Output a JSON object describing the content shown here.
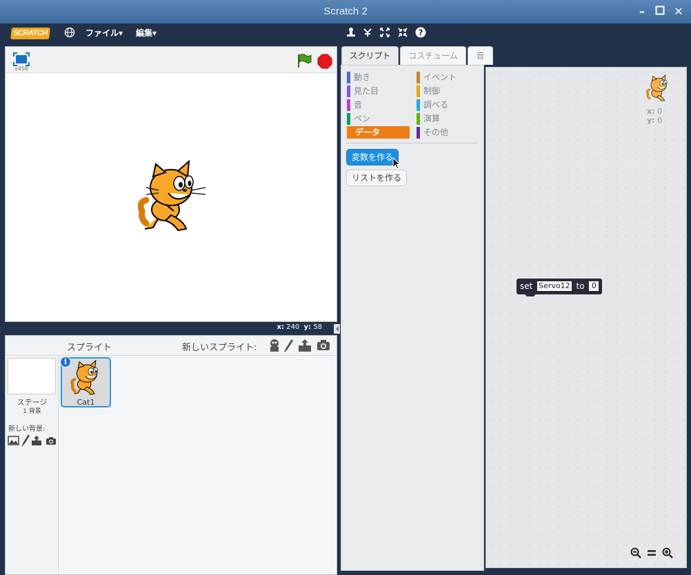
{
  "window": {
    "title": "Scratch 2",
    "minimize_icon": "minimize-icon",
    "maximize_icon": "maximize-icon",
    "close_icon": "close-icon"
  },
  "menu": {
    "logo_text": "SCRATCH",
    "file": "ファイル▾",
    "edit": "編集▾",
    "tools": [
      "duplicate-icon",
      "delete-icon",
      "grow-icon",
      "shrink-icon",
      "help-icon"
    ]
  },
  "stage": {
    "version": "v456",
    "mouse_x_label": "x:",
    "mouse_x": "240",
    "mouse_y_label": "y:",
    "mouse_y": "58"
  },
  "sprites": {
    "header": "スプライト",
    "new_sprite_label": "新しいスプライト:",
    "stage_label": "ステージ",
    "backdrop_count": "1 背景",
    "new_backdrop_label": "新しい背景:",
    "items": [
      {
        "name": "Cat1"
      }
    ]
  },
  "tabs": [
    "スクリプト",
    "コスチューム",
    "音"
  ],
  "categories_left": [
    {
      "label": "動き",
      "color": "#4a6cd4"
    },
    {
      "label": "見た目",
      "color": "#8a55d7"
    },
    {
      "label": "音",
      "color": "#bb42c3"
    },
    {
      "label": "ペン",
      "color": "#0e9a6c"
    },
    {
      "label": "データ",
      "color": "#ee7d16"
    }
  ],
  "categories_right": [
    {
      "label": "イベント",
      "color": "#c88330"
    },
    {
      "label": "制御",
      "color": "#e1a91a"
    },
    {
      "label": "調べる",
      "color": "#2ca5e2"
    },
    {
      "label": "演算",
      "color": "#5cb712"
    },
    {
      "label": "その他",
      "color": "#632d99"
    }
  ],
  "palette": {
    "make_variable": "変数を作る",
    "make_list": "リストを作る"
  },
  "script": {
    "block_set": "set",
    "block_var": "Servo12",
    "block_to": "to",
    "block_value": "0",
    "sprite_x_label": "x:",
    "sprite_x": "0",
    "sprite_y_label": "y:",
    "sprite_y": "0"
  },
  "zoom": {
    "out": "zoom-out-icon",
    "reset": "zoom-reset-icon",
    "in": "zoom-in-icon"
  }
}
